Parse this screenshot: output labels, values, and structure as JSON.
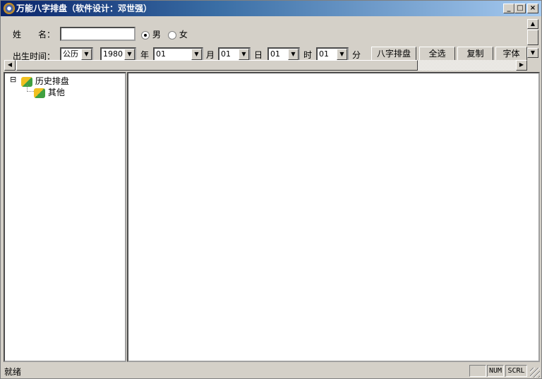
{
  "window": {
    "title": "万能八字排盘（软件设计：邓世强）",
    "min": "_",
    "max": "□",
    "close": "×"
  },
  "form": {
    "name_label": "姓　　名：",
    "name_value": "",
    "gender": [
      {
        "label": "男",
        "checked": true
      },
      {
        "label": "女",
        "checked": false
      }
    ],
    "birth_label": "出生时间：",
    "calendar": "公历",
    "year": "1980",
    "year_unit": "年",
    "month": "01",
    "month_unit": "月",
    "day": "01",
    "day_unit": "日",
    "hour": "01",
    "hour_unit": "时",
    "minute": "01",
    "minute_unit": "分"
  },
  "buttons": {
    "bazi": "八字排盘",
    "select_all": "全选",
    "copy": "复制",
    "font": "字体"
  },
  "tree": {
    "root": "历史排盘",
    "child": "其他",
    "expander": "⊟"
  },
  "status": {
    "text": "就绪",
    "num": "NUM",
    "scrl": "SCRL"
  }
}
